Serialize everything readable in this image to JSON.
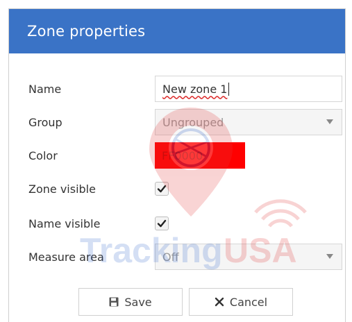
{
  "dialog": {
    "title": "Zone properties"
  },
  "form": {
    "name": {
      "label": "Name",
      "value": "New zone 1"
    },
    "group": {
      "label": "Group",
      "value": "Ungrouped"
    },
    "color": {
      "label": "Color",
      "value": "FF0000",
      "swatch": "#ff0000"
    },
    "zone_visible": {
      "label": "Zone visible",
      "checked": true
    },
    "name_visible": {
      "label": "Name visible",
      "checked": true
    },
    "measure_area": {
      "label": "Measure area",
      "value": "Off"
    }
  },
  "buttons": {
    "save_label": "Save",
    "cancel_label": "Cancel"
  },
  "watermark": {
    "text_left": "Tracking",
    "text_right": "USA"
  },
  "colors": {
    "header": "#3a73c6",
    "watermark_blue": "#2f62c9",
    "watermark_red": "#e23b3b"
  }
}
